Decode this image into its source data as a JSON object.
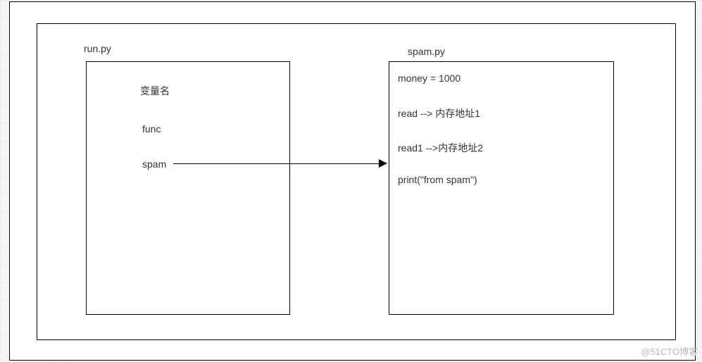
{
  "files": {
    "left_label": "run.py",
    "right_label": "spam.py"
  },
  "left_box": {
    "varname": "变量名",
    "func": "func",
    "spam": "spam"
  },
  "right_box": {
    "money": "money = 1000",
    "read": "read --> 内存地址1",
    "read1": "read1 -->内存地址2",
    "print": "print(\"from spam\")"
  },
  "watermark": "@51CTO博客"
}
